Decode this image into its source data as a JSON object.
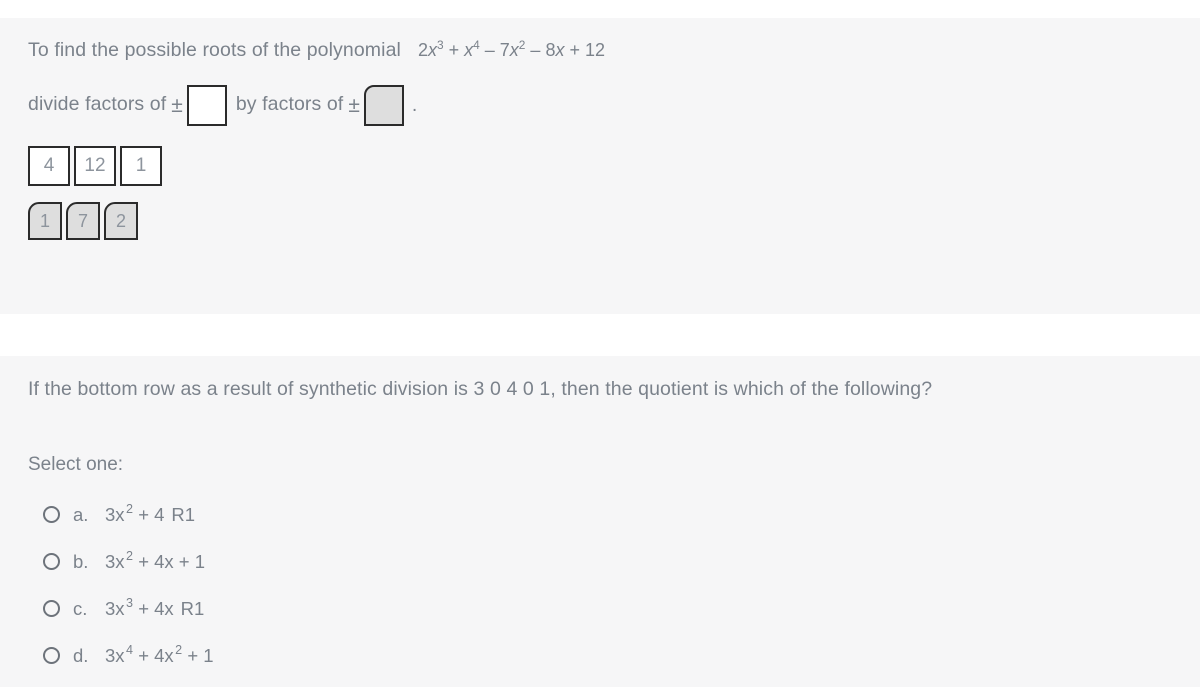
{
  "question1": {
    "prompt_part1": "To find the possible roots of the polynomial",
    "polynomial": {
      "t1_coef": "2",
      "t1_var": "x",
      "t1_exp": "3",
      "op1": "+",
      "t2_coef": "",
      "t2_var": "x",
      "t2_exp": "4",
      "op2": "–",
      "t3_coef": "7",
      "t3_var": "x",
      "t3_exp": "2",
      "op3": "–",
      "t4_coef": "8",
      "t4_var": "x",
      "op4": "+",
      "t5_const": "12",
      "plain": "2x3 + x4 – 7x2 – 8x + 12"
    },
    "prompt_part2": "divide factors of",
    "prompt_part3": "by factors of",
    "plus_minus_1": "±",
    "plus_minus_2": "±",
    "period": ".",
    "dropzone_1_value": "",
    "dropzone_2_value": "",
    "choice_row_1": [
      {
        "label": "4"
      },
      {
        "label": "12"
      },
      {
        "label": "1"
      }
    ],
    "choice_row_2": [
      {
        "label": "1"
      },
      {
        "label": "7"
      },
      {
        "label": "2"
      }
    ]
  },
  "question2": {
    "prompt": "If the bottom row as a result of synthetic division is 3 0 4 0 1, then the quotient is which of the following?",
    "select_one": "Select one:",
    "options": [
      {
        "letter": "a.",
        "coef": "3x",
        "exp": "2",
        "rest": "+ 4",
        "remainder": "R1",
        "plain": "3x2 + 4  R1"
      },
      {
        "letter": "b.",
        "coef": "3x",
        "exp": "2",
        "rest": "+ 4x + 1",
        "remainder": "",
        "plain": "3x2 + 4x + 1"
      },
      {
        "letter": "c.",
        "coef": "3x",
        "exp": "3",
        "rest": "+ 4x",
        "remainder": "R1",
        "plain": "3x3 + 4x  R1"
      },
      {
        "letter": "d.",
        "coef": "3x",
        "exp": "4",
        "rest": "+ 4x",
        "exp2": "2",
        "rest2": "+ 1",
        "remainder": "",
        "plain": "3x4 + 4x2 + 1"
      }
    ]
  },
  "colors": {
    "panel_bg": "#f6f6f7",
    "page_bg": "#ffffff",
    "text": "#7b828b",
    "box_border": "#2b2b2b",
    "token_fill": "#dedede",
    "radio_border": "#6d737b"
  }
}
